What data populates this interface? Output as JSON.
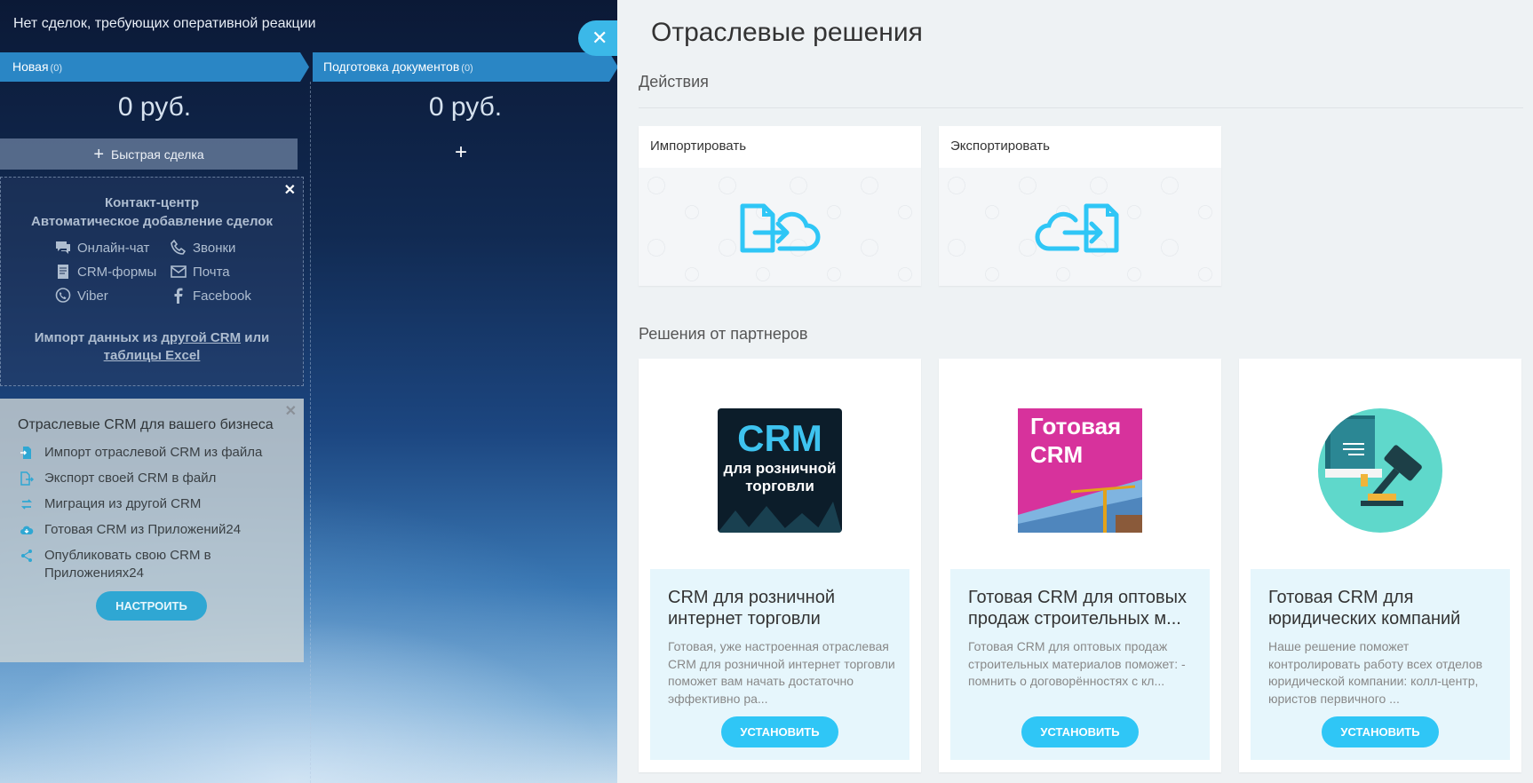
{
  "kanban": {
    "top_message": "Нет сделок, требующих оперативной реакции",
    "columns": [
      {
        "title": "Новая",
        "count": "(0)",
        "sum": "0 руб."
      },
      {
        "title": "Подготовка документов",
        "count": "(0)",
        "sum": "0 руб."
      }
    ],
    "quick_deal": "Быстрая сделка",
    "contact_center": {
      "title_1": "Контакт-центр",
      "title_2": "Автоматическое добавление сделок",
      "items": [
        "Онлайн-чат",
        "Звонки",
        "CRM-формы",
        "Почта",
        "Viber",
        "Facebook"
      ],
      "import_prefix": "Импорт данных из",
      "import_link_1": "другой CRM",
      "import_mid": "или",
      "import_link_2": "таблицы Excel"
    },
    "industry_box": {
      "title": "Отраслевые CRM для вашего бизнеса",
      "items": [
        "Импорт отраслевой CRM из файла",
        "Экспорт своей CRM в файл",
        "Миграция из другой CRM",
        "Готовая CRM из Приложений24",
        "Опубликовать свою CRM в Приложениях24"
      ],
      "button": "НАСТРОИТЬ"
    }
  },
  "panel": {
    "title": "Отраслевые решения",
    "actions_label": "Действия",
    "actions": [
      {
        "title": "Импортировать",
        "icon": "import-icon"
      },
      {
        "title": "Экспортировать",
        "icon": "export-icon"
      }
    ],
    "partners_label": "Решения от партнеров",
    "solutions": [
      {
        "name": "CRM для розничной интернет торговли",
        "description": "Готовая, уже настроенная отраслевая CRM для розничной интернет торговли поможет вам начать достаточно эффективно ра...",
        "logo_big": "CRM",
        "logo_small": "для розничной торговли",
        "button": "УСТАНОВИТЬ"
      },
      {
        "name": "Готовая CRM для оптовых продаж строительных м...",
        "description": "Готовая CRM для оптовых продаж строительных материалов поможет: - помнить о договорённостях с кл...",
        "logo_text": "Готовая CRM",
        "button": "УСТАНОВИТЬ"
      },
      {
        "name": "Готовая CRM для юридических компаний",
        "description": "Наше решение поможет контролировать работу всех отделов юридической компании: колл-центр, юристов первичного ...",
        "button": "УСТАНОВИТЬ"
      }
    ]
  },
  "colors": {
    "accent": "#2fc6f6",
    "column_head": "#2a86c5",
    "panel_bg": "#eef2f4"
  }
}
